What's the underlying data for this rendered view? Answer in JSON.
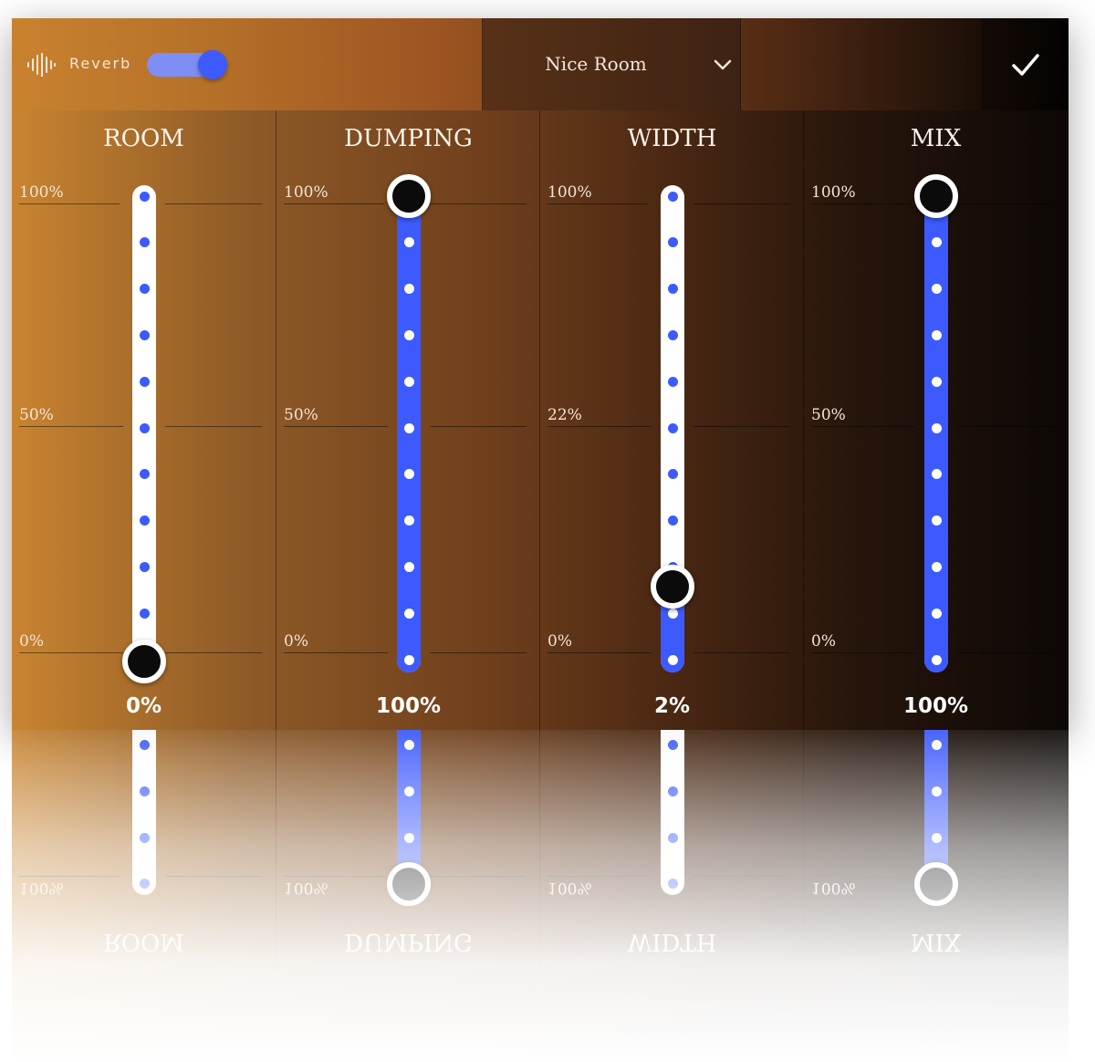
{
  "header": {
    "effect_label": "Reverb",
    "effect_enabled": true,
    "preset": "Nice Room",
    "icons": {
      "effect": "sound-wave-icon",
      "preset_dropdown": "chevron-down-icon",
      "confirm": "checkmark-icon"
    }
  },
  "channels": [
    {
      "title": "ROOM",
      "scale_top": "100%",
      "scale_mid": "50%",
      "scale_bottom": "0%",
      "value": 0,
      "value_label": "0%"
    },
    {
      "title": "DUMPING",
      "scale_top": "100%",
      "scale_mid": "50%",
      "scale_bottom": "0%",
      "value": 100,
      "value_label": "100%"
    },
    {
      "title": "WIDTH",
      "scale_top": "100%",
      "scale_mid": "22%",
      "scale_bottom": "0%",
      "value": 16,
      "value_label": "2%"
    },
    {
      "title": "MIX",
      "scale_top": "100%",
      "scale_mid": "50%",
      "scale_bottom": "0%",
      "value": 100,
      "value_label": "100%"
    }
  ],
  "colors": {
    "accent": "#3d5afe",
    "toggle_track": "#7e8ef5",
    "track": "#ffffff",
    "thumb": "#0b0b0b",
    "text": "#fbf3ea"
  }
}
